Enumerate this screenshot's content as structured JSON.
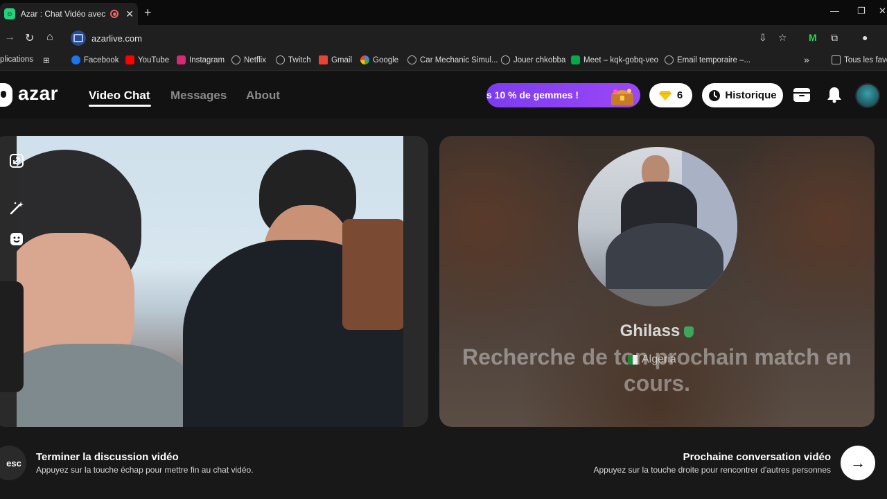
{
  "browser": {
    "tab_title": "Azar : Chat Vidéo avec de n",
    "tab_close": "✕",
    "new_tab": "+",
    "url": "azarlive.com",
    "bookmarks": [
      "plications",
      "Facebook",
      "YouTube",
      "Instagram",
      "Netflix",
      "Twitch",
      "Gmail",
      "Google",
      "Car Mechanic Simul...",
      "Jouer chkobba",
      "Meet – kqk-gobq-veo",
      "Email temporaire –...",
      "Tous les favo"
    ],
    "bookmarks_overflow": "»"
  },
  "header": {
    "logo": "azar",
    "nav": {
      "video_chat": "Video Chat",
      "messages": "Messages",
      "about": "About"
    },
    "promo": "s 10 % de gemmes !",
    "gems_count": "6",
    "history": "Historique"
  },
  "match": {
    "name": "Ghilass",
    "country": "Algeria",
    "searching": "Recherche de ton prochain match en cours."
  },
  "footer": {
    "esc_key": "esc",
    "end_title": "Terminer la discussion vidéo",
    "end_sub": "Appuyez sur la touche échap pour mettre fin au chat vidéo.",
    "next_title": "Prochaine conversation vidéo",
    "next_sub": "Appuyez sur la touche droite pour rencontrer d'autres personnes",
    "next_arrow": "→"
  },
  "colors": {
    "accent_purple": "#7d3cf2",
    "brand_green": "#26d07c",
    "verified_green": "#3fa55a"
  }
}
